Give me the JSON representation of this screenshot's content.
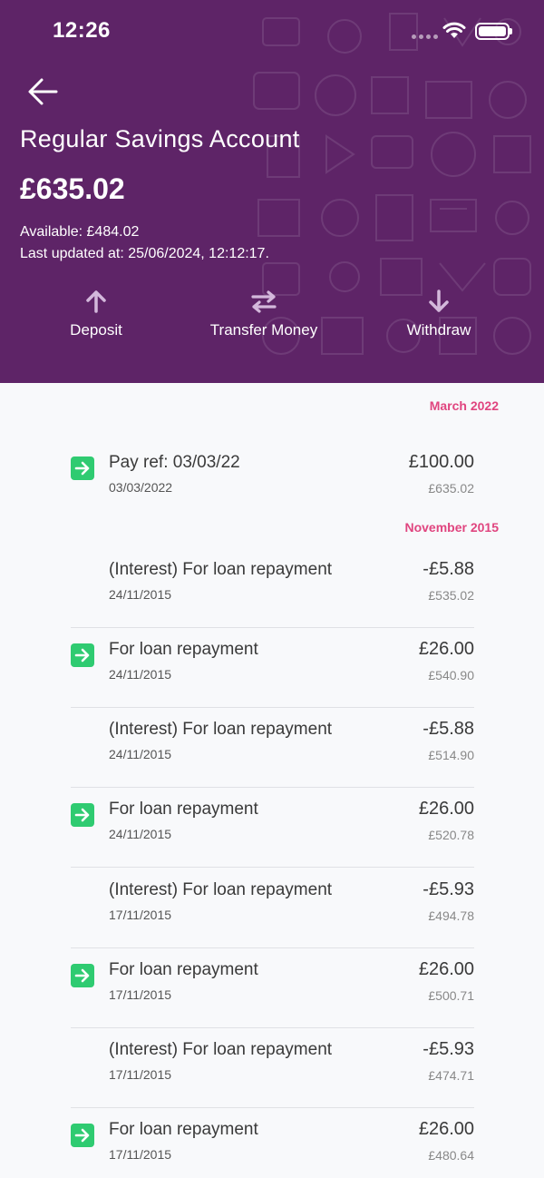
{
  "status": {
    "time": "12:26"
  },
  "account": {
    "title": "Regular Savings Account",
    "balance": "£635.02",
    "available": "Available: £484.02",
    "last_updated": "Last updated at: 25/06/2024, 12:12:17."
  },
  "actions": [
    {
      "label": "Deposit",
      "icon": "arrow-up-icon"
    },
    {
      "label": "Transfer Money",
      "icon": "transfer-icon"
    },
    {
      "label": "Withdraw",
      "icon": "arrow-down-icon"
    }
  ],
  "colors": {
    "header": "#5e2467",
    "accent_month": "#e0457f",
    "credit_icon": "#2fcb71"
  },
  "months": [
    "March 2022",
    "November 2015"
  ],
  "transactions": [
    {
      "description": "Pay ref: 03/03/22",
      "date": "03/03/2022",
      "amount": "£100.00",
      "balance": "£635.02",
      "credit": true
    },
    {
      "description": "(Interest) For loan repayment",
      "date": "24/11/2015",
      "amount": "-£5.88",
      "balance": "£535.02",
      "credit": false
    },
    {
      "description": "For loan repayment",
      "date": "24/11/2015",
      "amount": "£26.00",
      "balance": "£540.90",
      "credit": true
    },
    {
      "description": "(Interest) For loan repayment",
      "date": "24/11/2015",
      "amount": "-£5.88",
      "balance": "£514.90",
      "credit": false
    },
    {
      "description": "For loan repayment",
      "date": "24/11/2015",
      "amount": "£26.00",
      "balance": "£520.78",
      "credit": true
    },
    {
      "description": "(Interest) For loan repayment",
      "date": "17/11/2015",
      "amount": "-£5.93",
      "balance": "£494.78",
      "credit": false
    },
    {
      "description": "For loan repayment",
      "date": "17/11/2015",
      "amount": "£26.00",
      "balance": "£500.71",
      "credit": true
    },
    {
      "description": "(Interest) For loan repayment",
      "date": "17/11/2015",
      "amount": "-£5.93",
      "balance": "£474.71",
      "credit": false
    },
    {
      "description": "For loan repayment",
      "date": "17/11/2015",
      "amount": "£26.00",
      "balance": "£480.64",
      "credit": true
    }
  ]
}
